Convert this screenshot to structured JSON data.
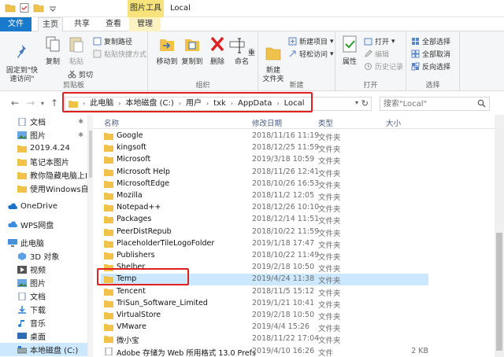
{
  "window": {
    "title": "Local",
    "context_tab": "图片工具"
  },
  "tabs": {
    "file": "文件",
    "home": "主页",
    "share": "共享",
    "view": "查看",
    "manage": "管理"
  },
  "ribbon": {
    "clipboard": {
      "label": "剪贴板",
      "pin": "固定到\"快\n速访问\"",
      "copy": "复制",
      "paste": "粘贴",
      "copy_path": "复制路径",
      "paste_shortcut": "粘贴快捷方式",
      "cut": "剪切"
    },
    "organize": {
      "label": "组织",
      "move_to": "移动到",
      "copy_to": "复制到",
      "delete": "删除",
      "rename": "重命名"
    },
    "new": {
      "label": "新建",
      "new_folder": "新建\n文件夹",
      "new_item": "新建项目",
      "easy_access": "轻松访问"
    },
    "open": {
      "label": "打开",
      "properties": "属性",
      "open": "打开",
      "edit": "编辑",
      "history": "历史记录"
    },
    "select": {
      "label": "选择",
      "select_all": "全部选择",
      "select_none": "全部取消",
      "invert": "反向选择"
    }
  },
  "address": {
    "crumbs": [
      "此电脑",
      "本地磁盘 (C:)",
      "用户",
      "txk",
      "AppData",
      "Local"
    ],
    "search_placeholder": "搜索\"Local\""
  },
  "sidebar": {
    "items": [
      {
        "label": "文档",
        "icon": "documents-icon",
        "pinned": true
      },
      {
        "label": "图片",
        "icon": "pictures-icon",
        "pinned": true
      },
      {
        "label": "2019.4.24",
        "icon": "folder-icon",
        "pinned": false
      },
      {
        "label": "笔记本图片",
        "icon": "folder-icon",
        "pinned": false
      },
      {
        "label": "教你隐藏电脑上I",
        "icon": "folder-icon",
        "pinned": false
      },
      {
        "label": "使用Windows自",
        "icon": "folder-icon",
        "pinned": false
      },
      {
        "label": "OneDrive",
        "icon": "onedrive-icon",
        "pinned": false
      },
      {
        "label": "WPS网盘",
        "icon": "wps-cloud-icon",
        "pinned": false
      },
      {
        "label": "此电脑",
        "icon": "computer-icon",
        "pinned": false
      },
      {
        "label": "3D 对象",
        "icon": "3d-objects-icon",
        "pinned": false
      },
      {
        "label": "视频",
        "icon": "videos-icon",
        "pinned": false
      },
      {
        "label": "图片",
        "icon": "pictures-icon",
        "pinned": false
      },
      {
        "label": "文档",
        "icon": "documents-icon",
        "pinned": false
      },
      {
        "label": "下载",
        "icon": "downloads-icon",
        "pinned": false
      },
      {
        "label": "音乐",
        "icon": "music-icon",
        "pinned": false
      },
      {
        "label": "桌面",
        "icon": "desktop-icon",
        "pinned": false
      },
      {
        "label": "本地磁盘 (C:)",
        "icon": "drive-icon",
        "pinned": false
      }
    ]
  },
  "list": {
    "columns": {
      "name": "名称",
      "date": "修改日期",
      "type": "类型",
      "size": "大小"
    },
    "rows": [
      {
        "name": "Google",
        "date": "2018/11/16 11:19",
        "type": "文件夹",
        "size": ""
      },
      {
        "name": "kingsoft",
        "date": "2018/12/25 11:59",
        "type": "文件夹",
        "size": ""
      },
      {
        "name": "Microsoft",
        "date": "2019/3/18 10:59",
        "type": "文件夹",
        "size": ""
      },
      {
        "name": "Microsoft Help",
        "date": "2018/11/26 12:41",
        "type": "文件夹",
        "size": ""
      },
      {
        "name": "MicrosoftEdge",
        "date": "2018/10/26 16:53",
        "type": "文件夹",
        "size": ""
      },
      {
        "name": "Mozilla",
        "date": "2018/11/2 12:05",
        "type": "文件夹",
        "size": ""
      },
      {
        "name": "Notepad++",
        "date": "2018/12/26 10:10",
        "type": "文件夹",
        "size": ""
      },
      {
        "name": "Packages",
        "date": "2018/12/14 11:51",
        "type": "文件夹",
        "size": ""
      },
      {
        "name": "PeerDistRepub",
        "date": "2018/10/22 11:59",
        "type": "文件夹",
        "size": ""
      },
      {
        "name": "PlaceholderTileLogoFolder",
        "date": "2019/1/18 17:47",
        "type": "文件夹",
        "size": ""
      },
      {
        "name": "Publishers",
        "date": "2018/10/22 11:49",
        "type": "文件夹",
        "size": ""
      },
      {
        "name": "Shelher",
        "date": "2019/2/18 10:50",
        "type": "文件夹",
        "size": ""
      },
      {
        "name": "Temp",
        "date": "2019/4/24 11:38",
        "type": "文件夹",
        "size": ""
      },
      {
        "name": "Tencent",
        "date": "2018/11/5 15:12",
        "type": "文件夹",
        "size": ""
      },
      {
        "name": "TriSun_Software_Limited",
        "date": "2019/1/21 10:41",
        "type": "文件夹",
        "size": ""
      },
      {
        "name": "VirtualStore",
        "date": "2019/2/18 10:50",
        "type": "文件夹",
        "size": ""
      },
      {
        "name": "VMware",
        "date": "2019/4/4 15:26",
        "type": "文件夹",
        "size": ""
      },
      {
        "name": "微小宝",
        "date": "2018/11/22 17:04",
        "type": "文件夹",
        "size": ""
      },
      {
        "name": "Adobe 存储为 Web 所用格式 13.0 Prefs",
        "date": "2019/4/10 16:26",
        "type": "文件",
        "size": "2 KB"
      }
    ]
  },
  "colors": {
    "file_tab": "#1979ca",
    "selection": "#cce8ff",
    "folder": "#f0c24a",
    "annotation": "#e02020"
  }
}
